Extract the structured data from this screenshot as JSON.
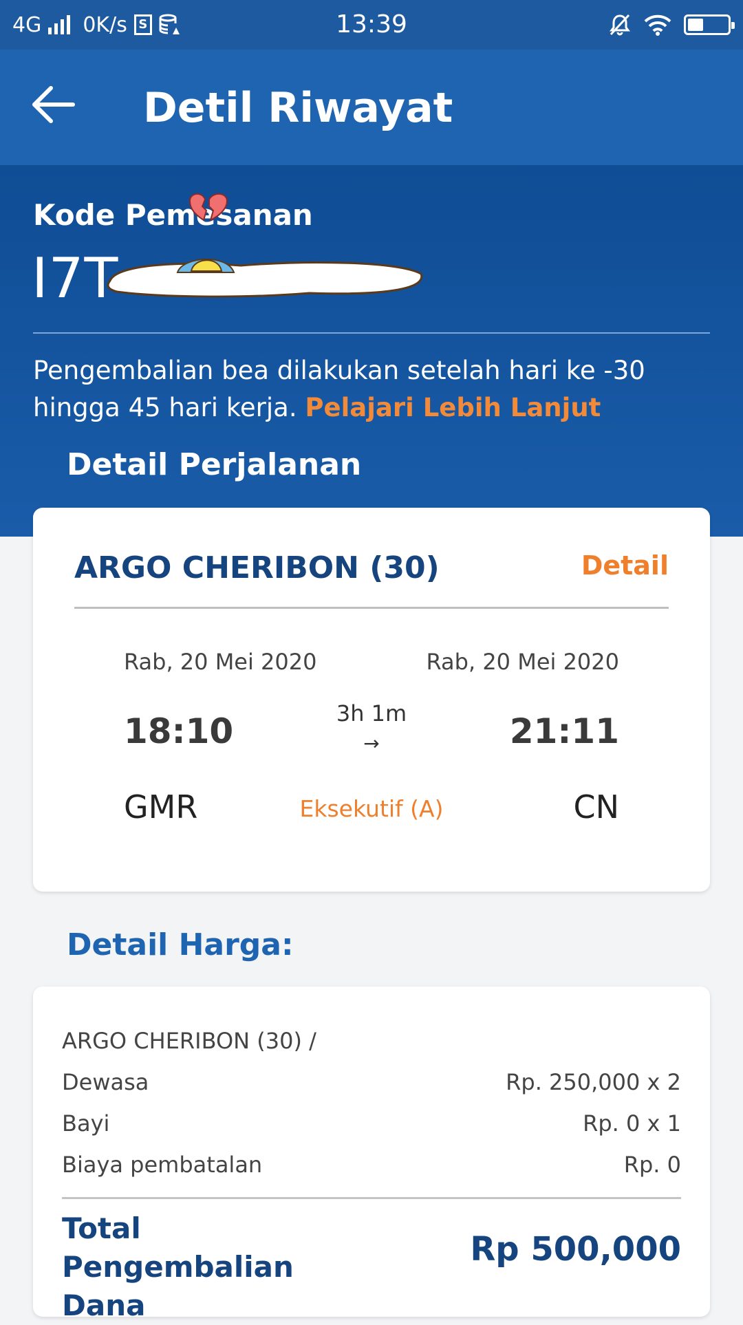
{
  "status_bar": {
    "network": "4G",
    "speed": "0K/s",
    "time": "13:39",
    "battery_level": 0.4
  },
  "header": {
    "title": "Detil Riwayat"
  },
  "booking": {
    "code_label": "Kode Pemesanan",
    "code_value_visible": "I7T",
    "refund_note": "Pengembalian bea dilakukan setelah hari ke -30 hingga 45 hari kerja.",
    "learn_more": "Pelajari Lebih Lanjut"
  },
  "trip": {
    "heading": "Detail Perjalanan",
    "train_name": "ARGO CHERIBON (30)",
    "detail_link": "Detail",
    "departure": {
      "date": "Rab, 20 Mei 2020",
      "time": "18:10",
      "station": "GMR"
    },
    "arrival": {
      "date": "Rab, 20 Mei 2020",
      "time": "21:11",
      "station": "CN"
    },
    "duration": "3h 1m",
    "class": "Eksekutif (A)"
  },
  "price": {
    "heading": "Detail Harga:",
    "train_line": "ARGO CHERIBON (30) /",
    "rows": [
      {
        "label": "Dewasa",
        "value": "Rp. 250,000 x 2"
      },
      {
        "label": "Bayi",
        "value": "Rp. 0 x 1"
      },
      {
        "label": "Biaya pembatalan",
        "value": "Rp. 0"
      }
    ],
    "total_label": "Total Pengembalian Dana",
    "total_value": "Rp 500,000"
  },
  "colors": {
    "primary": "#1e64b0",
    "accent": "#f07f2c",
    "navy": "#15447f"
  }
}
